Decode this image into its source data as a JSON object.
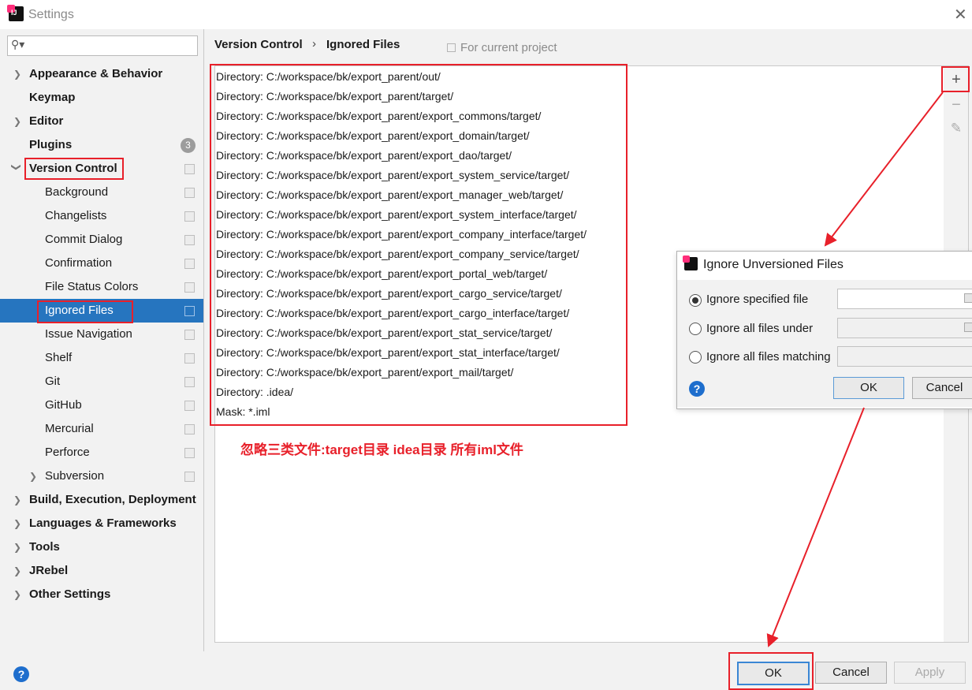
{
  "window": {
    "title": "Settings"
  },
  "sidebar": {
    "search_placeholder": "",
    "items": [
      {
        "label": "Appearance & Behavior"
      },
      {
        "label": "Keymap"
      },
      {
        "label": "Editor"
      },
      {
        "label": "Plugins",
        "badge": "3"
      },
      {
        "label": "Version Control"
      },
      {
        "label": "Background"
      },
      {
        "label": "Changelists"
      },
      {
        "label": "Commit Dialog"
      },
      {
        "label": "Confirmation"
      },
      {
        "label": "File Status Colors"
      },
      {
        "label": "Ignored Files"
      },
      {
        "label": "Issue Navigation"
      },
      {
        "label": "Shelf"
      },
      {
        "label": "Git"
      },
      {
        "label": "GitHub"
      },
      {
        "label": "Mercurial"
      },
      {
        "label": "Perforce"
      },
      {
        "label": "Subversion"
      },
      {
        "label": "Build, Execution, Deployment"
      },
      {
        "label": "Languages & Frameworks"
      },
      {
        "label": "Tools"
      },
      {
        "label": "JRebel"
      },
      {
        "label": "Other Settings"
      }
    ]
  },
  "breadcrumb": {
    "parent": "Version Control",
    "separator": "›",
    "current": "Ignored Files",
    "scope": "For current project"
  },
  "ignored": [
    "Directory: C:/workspace/bk/export_parent/out/",
    "Directory: C:/workspace/bk/export_parent/target/",
    "Directory: C:/workspace/bk/export_parent/export_commons/target/",
    "Directory: C:/workspace/bk/export_parent/export_domain/target/",
    "Directory: C:/workspace/bk/export_parent/export_dao/target/",
    "Directory: C:/workspace/bk/export_parent/export_system_service/target/",
    "Directory: C:/workspace/bk/export_parent/export_manager_web/target/",
    "Directory: C:/workspace/bk/export_parent/export_system_interface/target/",
    "Directory: C:/workspace/bk/export_parent/export_company_interface/target/",
    "Directory: C:/workspace/bk/export_parent/export_company_service/target/",
    "Directory: C:/workspace/bk/export_parent/export_portal_web/target/",
    "Directory: C:/workspace/bk/export_parent/export_cargo_service/target/",
    "Directory: C:/workspace/bk/export_parent/export_cargo_interface/target/",
    "Directory: C:/workspace/bk/export_parent/export_stat_service/target/",
    "Directory: C:/workspace/bk/export_parent/export_stat_interface/target/",
    "Directory: C:/workspace/bk/export_parent/export_mail/target/",
    "Directory: .idea/",
    "Mask: *.iml"
  ],
  "annotation": "忽略三类文件:target目录 idea目录  所有iml文件",
  "toolbar": {
    "add": "+",
    "remove": "−",
    "edit": "✎"
  },
  "dialog": {
    "title": "Ignore Unversioned Files",
    "options": [
      {
        "label": "Ignore specified file",
        "selected": true
      },
      {
        "label": "Ignore all files under",
        "selected": false
      },
      {
        "label": "Ignore all files matching",
        "selected": false
      }
    ],
    "ok": "OK",
    "cancel": "Cancel"
  },
  "footer": {
    "ok": "OK",
    "cancel": "Cancel",
    "apply": "Apply",
    "help": "?"
  },
  "colors": {
    "selection": "#2675bf",
    "annotation_red": "#e8202a",
    "help_blue": "#1e6ecd"
  }
}
